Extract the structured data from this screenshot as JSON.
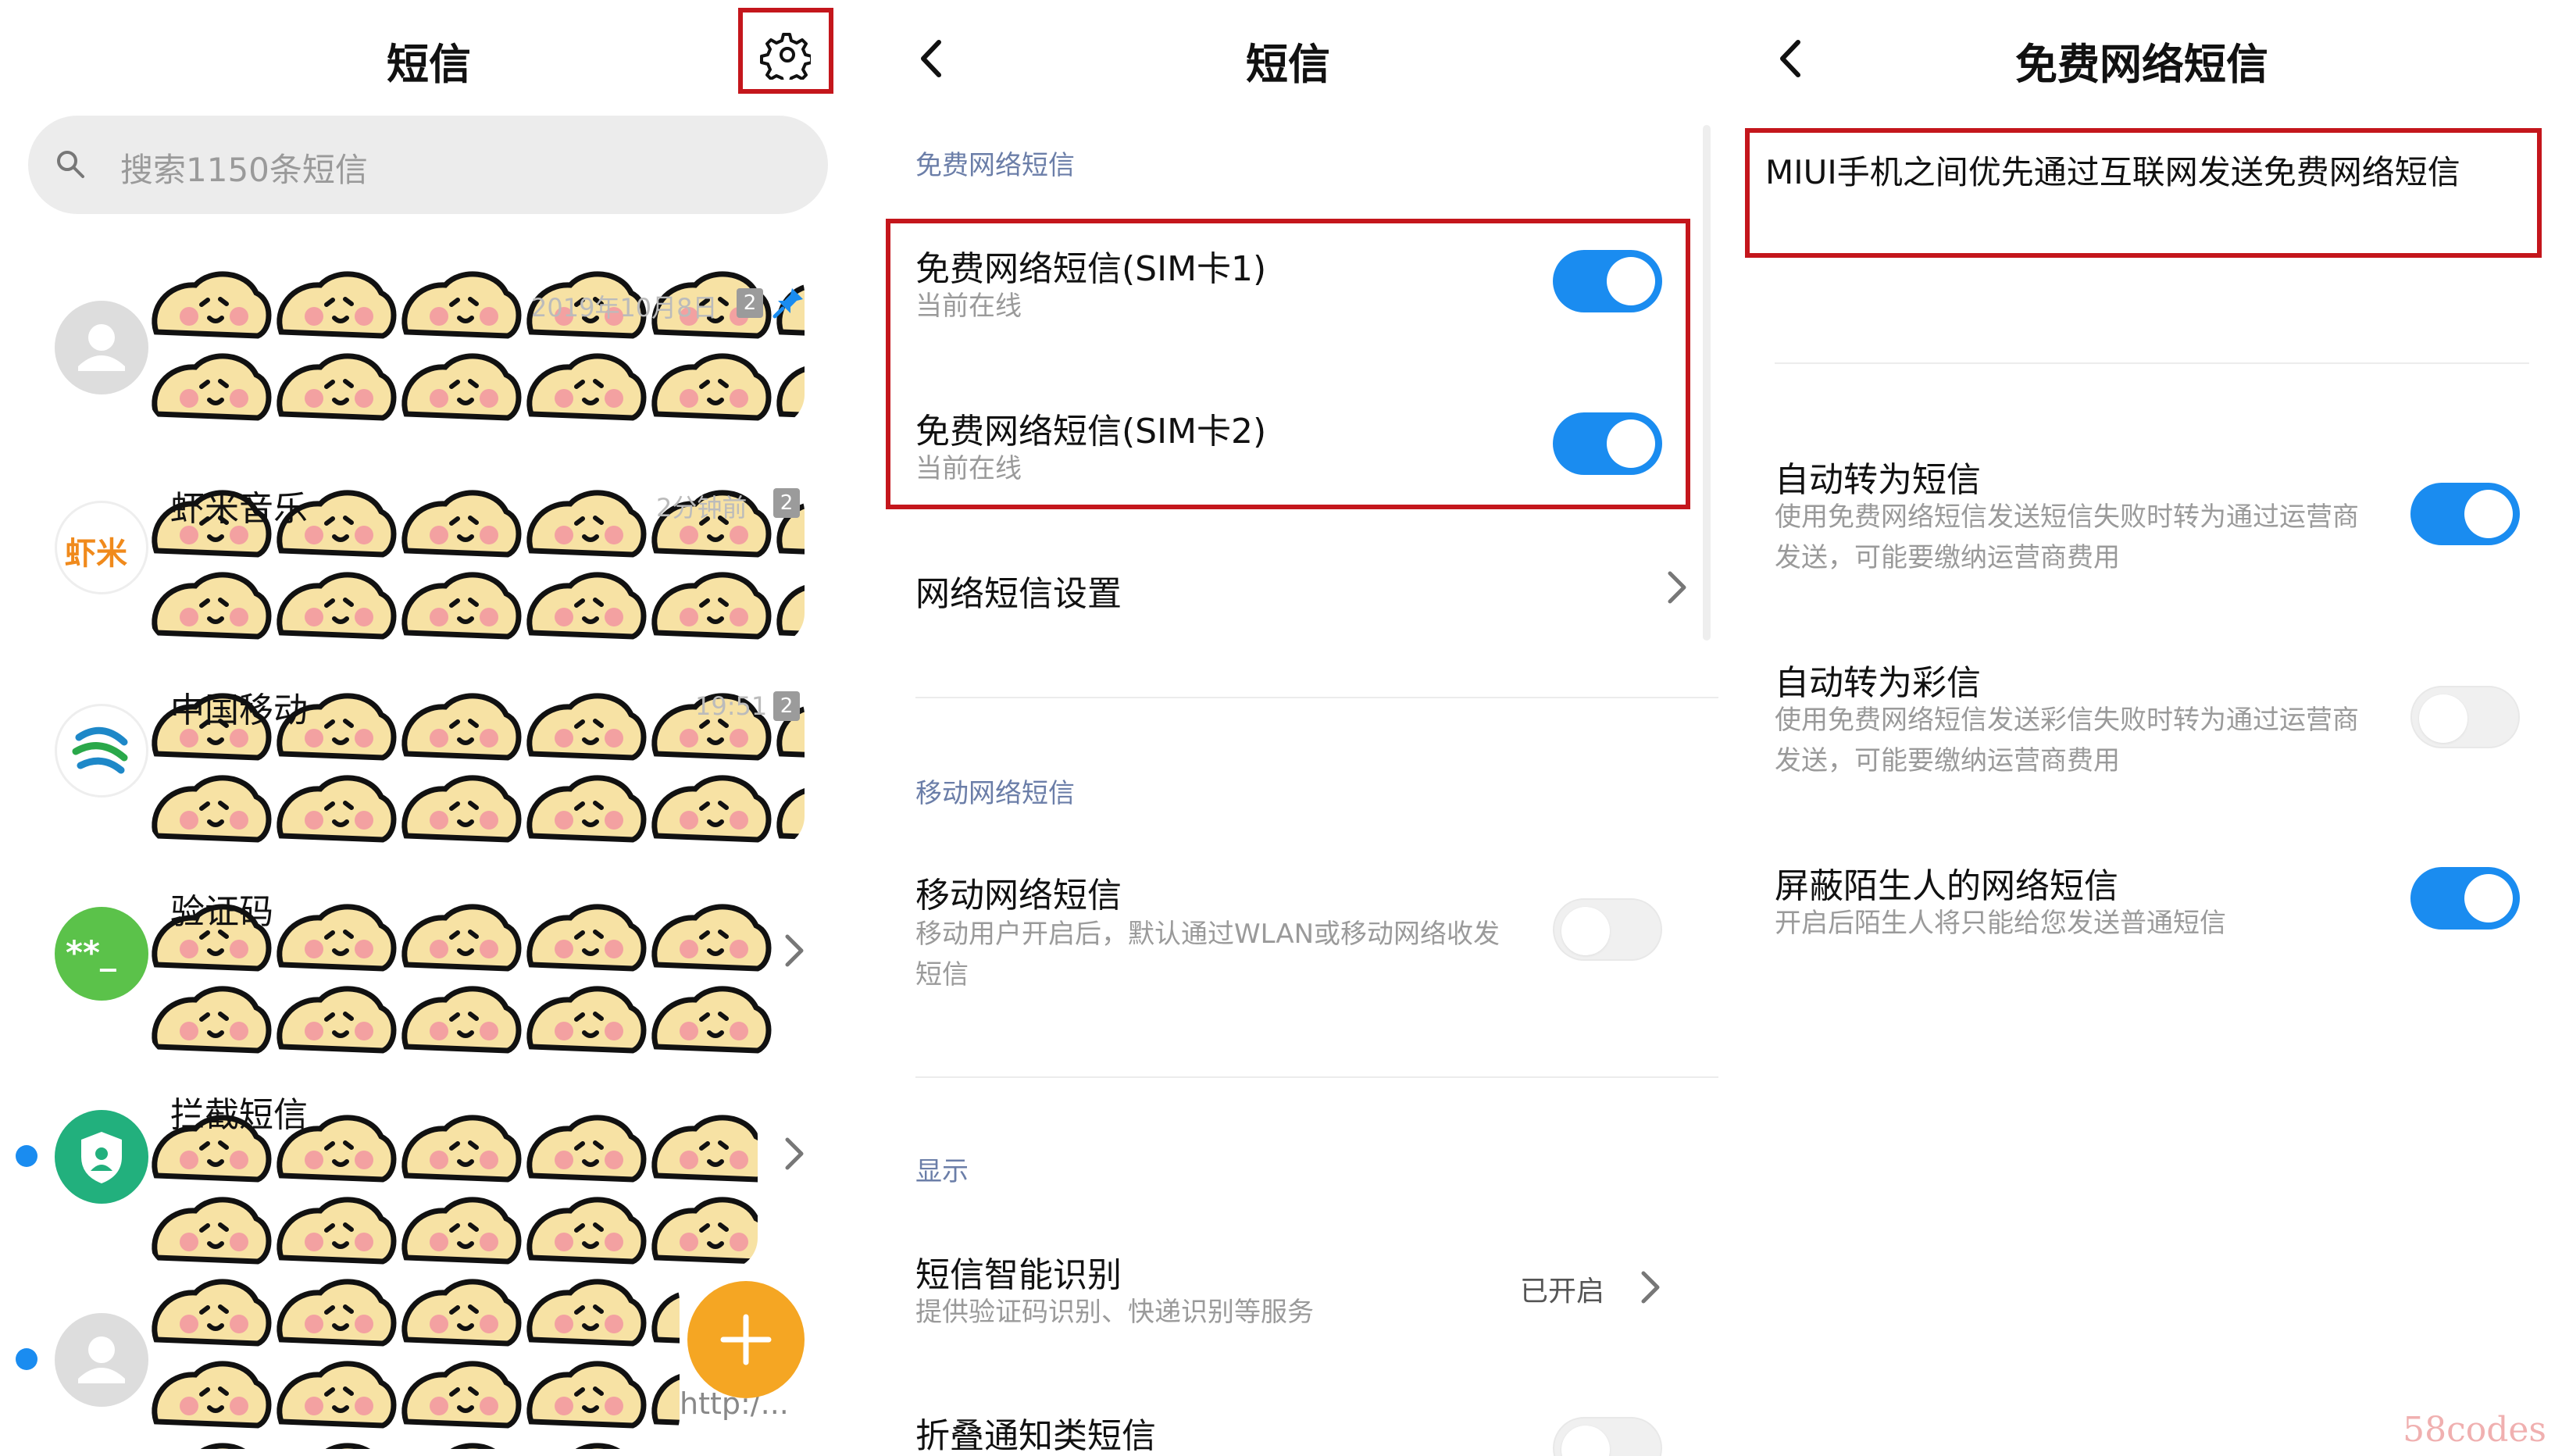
{
  "panel1": {
    "title": "短信",
    "search_placeholder": "搜索1150条短信",
    "conversations": [
      {
        "name": "",
        "time": "2019年10月8日",
        "count": "2",
        "pinned": true,
        "preview": ""
      },
      {
        "name": "虾米音乐",
        "avatar_text": "虾米",
        "time": "2分钟前",
        "count": "2",
        "preview": ""
      },
      {
        "name": "中国移动",
        "time": "19:51",
        "count": "2",
        "preview": ""
      },
      {
        "name": "验证码",
        "avatar_text": "**_",
        "time": "",
        "count": "",
        "preview": ""
      },
      {
        "name": "拦截短信",
        "time": "",
        "count": "",
        "preview": ""
      },
      {
        "name": "",
        "time": "",
        "count": "",
        "preview": "http:/..."
      }
    ]
  },
  "panel2": {
    "title": "短信",
    "sections": {
      "free": "免费网络短信",
      "mobile": "移动网络短信",
      "display": "显示"
    },
    "items": {
      "sim1": {
        "title": "免费网络短信(SIM卡1)",
        "subtitle": "当前在线",
        "enabled": true
      },
      "sim2": {
        "title": "免费网络短信(SIM卡2)",
        "subtitle": "当前在线",
        "enabled": true
      },
      "settings": {
        "title": "网络短信设置"
      },
      "mobile_sms": {
        "title": "移动网络短信",
        "subtitle": "移动用户开启后，默认通过WLAN或移动网络收发短信",
        "enabled": false
      },
      "smart": {
        "title": "短信智能识别",
        "subtitle": "提供验证码识别、快递识别等服务",
        "value": "已开启"
      },
      "fold": {
        "title": "折叠通知类短信",
        "enabled": false
      }
    }
  },
  "panel3": {
    "title": "免费网络短信",
    "intro": "MIUI手机之间优先通过互联网发送免费网络短信",
    "items": {
      "auto_sms": {
        "title": "自动转为短信",
        "subtitle": "使用免费网络短信发送短信失败时转为通过运营商发送，可能要缴纳运营商费用",
        "enabled": true
      },
      "auto_mms": {
        "title": "自动转为彩信",
        "subtitle": "使用免费网络短信发送彩信失败时转为通过运营商发送，可能要缴纳运营商费用",
        "enabled": false
      },
      "block": {
        "title": "屏蔽陌生人的网络短信",
        "subtitle": "开启后陌生人将只能给您发送普通短信",
        "enabled": true
      }
    }
  },
  "watermark": "58codes",
  "colors": {
    "accent": "#1a8cf0",
    "highlight": "#c4161c",
    "fab": "#f5a623",
    "section": "#6b7ea8"
  }
}
